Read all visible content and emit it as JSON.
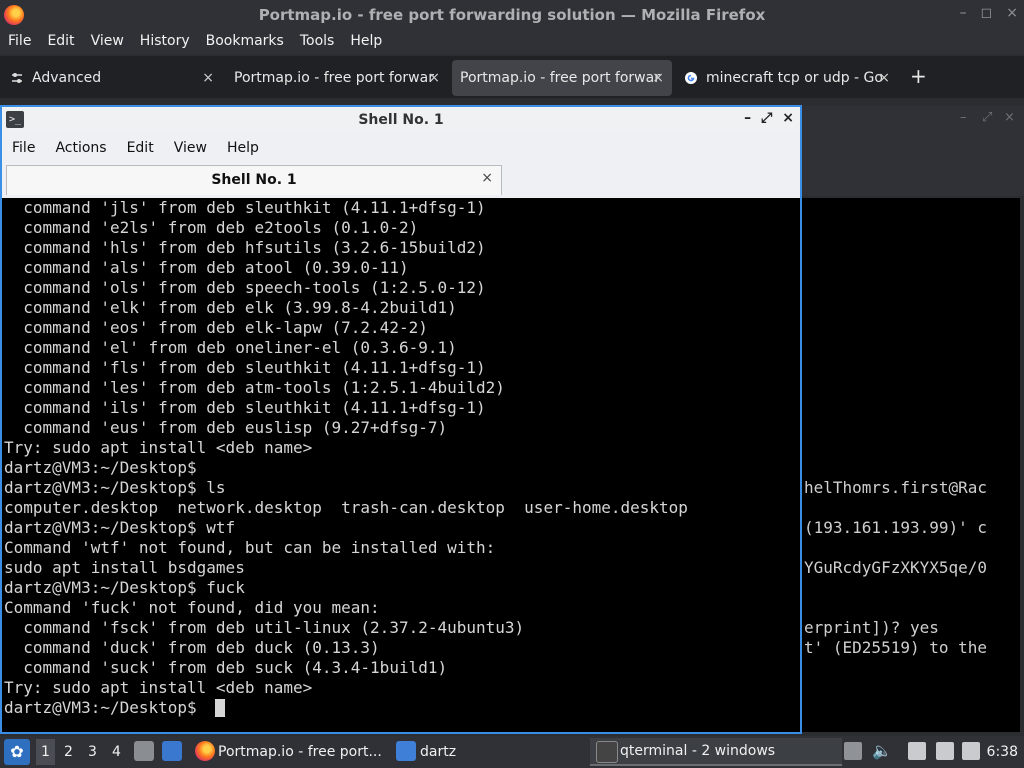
{
  "firefox": {
    "title": "Portmap.io - free port forwarding solution — Mozilla Firefox",
    "menu": [
      "File",
      "Edit",
      "View",
      "History",
      "Bookmarks",
      "Tools",
      "Help"
    ],
    "tabs": [
      {
        "label": "Advanced",
        "close": "×"
      },
      {
        "label": "Portmap.io - free port forwar",
        "close": "×"
      },
      {
        "label": "Portmap.io - free port forwar",
        "close": "×"
      },
      {
        "label": "minecraft tcp or udp - Go",
        "close": "×"
      }
    ],
    "new_tab": "+",
    "window_buttons": [
      "–",
      "◻",
      "×"
    ]
  },
  "shell": {
    "title": "Shell No. 1",
    "menu": [
      "File",
      "Actions",
      "Edit",
      "View",
      "Help"
    ],
    "tab_label": "Shell No. 1",
    "tab_close": "×",
    "window_buttons": [
      "–",
      "⤢",
      "×"
    ],
    "lines": [
      "  command 'jls' from deb sleuthkit (4.11.1+dfsg-1)",
      "  command 'e2ls' from deb e2tools (0.1.0-2)",
      "  command 'hls' from deb hfsutils (3.2.6-15build2)",
      "  command 'als' from deb atool (0.39.0-11)",
      "  command 'ols' from deb speech-tools (1:2.5.0-12)",
      "  command 'elk' from deb elk (3.99.8-4.2build1)",
      "  command 'eos' from deb elk-lapw (7.2.42-2)",
      "  command 'el' from deb oneliner-el (0.3.6-9.1)",
      "  command 'fls' from deb sleuthkit (4.11.1+dfsg-1)",
      "  command 'les' from deb atm-tools (1:2.5.1-4build2)",
      "  command 'ils' from deb sleuthkit (4.11.1+dfsg-1)",
      "  command 'eus' from deb euslisp (9.27+dfsg-7)",
      "Try: sudo apt install <deb name>",
      "dartz@VM3:~/Desktop$",
      "dartz@VM3:~/Desktop$ ls",
      "computer.desktop  network.desktop  trash-can.desktop  user-home.desktop",
      "dartz@VM3:~/Desktop$ wtf",
      "Command 'wtf' not found, but can be installed with:",
      "sudo apt install bsdgames",
      "dartz@VM3:~/Desktop$ fuck",
      "Command 'fuck' not found, did you mean:",
      "  command 'fsck' from deb util-linux (2.37.2-4ubuntu3)",
      "  command 'duck' from deb duck (0.13.3)",
      "  command 'suck' from deb suck (4.3.4-1build1)",
      "Try: sudo apt install <deb name>",
      "dartz@VM3:~/Desktop$ "
    ]
  },
  "background_terminal": {
    "lines": [
      {
        "row": 14,
        "text": "helThomrs.first@Rac"
      },
      {
        "row": 16,
        "text": "(193.161.193.99)' c"
      },
      {
        "row": 18,
        "text": "YGuRcdyGFzXKYX5qe/0"
      },
      {
        "row": 21,
        "text": "erprint])? yes"
      },
      {
        "row": 22,
        "text": "t' (ED25519) to the"
      }
    ]
  },
  "taskbar": {
    "workspaces": [
      "1",
      "2",
      "3",
      "4"
    ],
    "active_workspace": "1",
    "firefox_task": "Portmap.io - free port...",
    "folder_task": "dartz",
    "terminal_task": "qterminal - 2 windows",
    "clock": "6:38"
  },
  "colors": {
    "accent": "#3a8ee6",
    "terminal_bg": "#000000",
    "terminal_fg": "#d6d6d6"
  }
}
